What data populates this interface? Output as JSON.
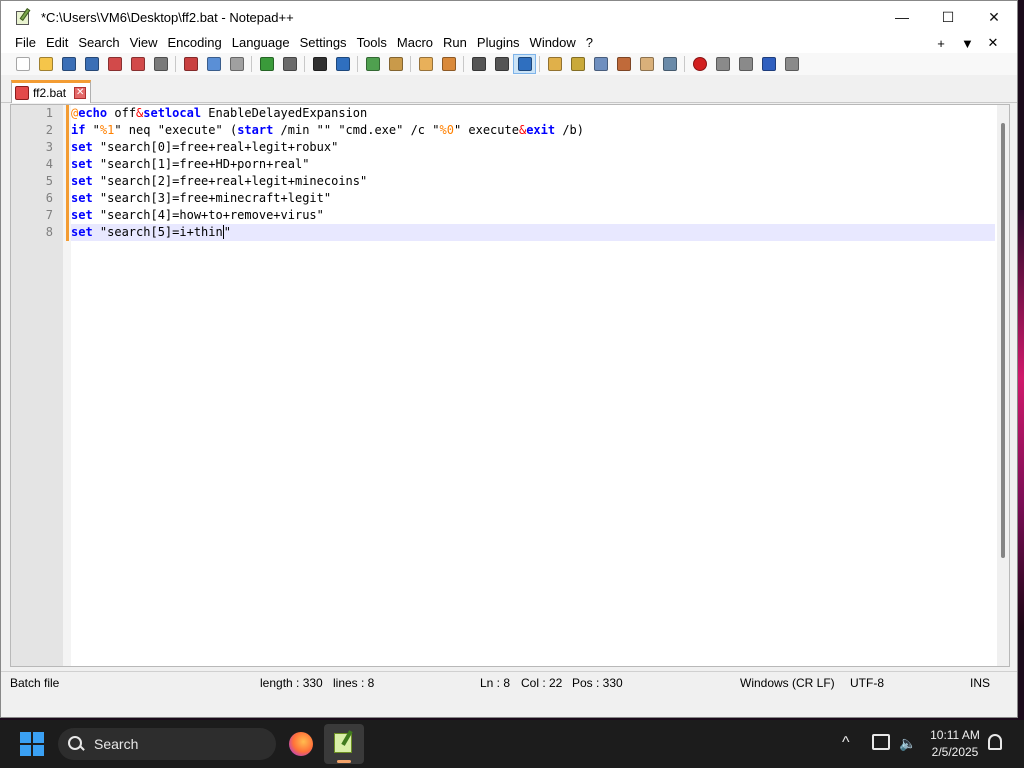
{
  "window": {
    "title": "*C:\\Users\\VM6\\Desktop\\ff2.bat - Notepad++",
    "controls": {
      "minimize": "—",
      "maximize": "☐",
      "close": "✕"
    }
  },
  "menu": {
    "items": [
      "File",
      "Edit",
      "Search",
      "View",
      "Encoding",
      "Language",
      "Settings",
      "Tools",
      "Macro",
      "Run",
      "Plugins",
      "Window",
      "?"
    ],
    "right": {
      "plus": "+",
      "dropdown": "▼",
      "close": "✕"
    }
  },
  "toolbar": {
    "buttons": [
      {
        "name": "new-file",
        "color": "#ffffff"
      },
      {
        "name": "open-file",
        "color": "#f5c54a"
      },
      {
        "name": "save",
        "color": "#3b6fb6"
      },
      {
        "name": "save-all",
        "color": "#3b6fb6"
      },
      {
        "name": "close",
        "color": "#d24a4a"
      },
      {
        "name": "close-all",
        "color": "#d24a4a"
      },
      {
        "name": "print",
        "color": "#7a7a7a"
      },
      {
        "name": "cut",
        "color": "#c94040"
      },
      {
        "name": "copy",
        "color": "#5a8fd6"
      },
      {
        "name": "paste",
        "color": "#a0a0a0"
      },
      {
        "name": "undo",
        "color": "#3a9a3a"
      },
      {
        "name": "redo",
        "color": "#6a6a6a"
      },
      {
        "name": "find",
        "color": "#303030"
      },
      {
        "name": "replace",
        "color": "#2f6fbf"
      },
      {
        "name": "zoom-in",
        "color": "#4fa04f"
      },
      {
        "name": "zoom-out",
        "color": "#c99a4a"
      },
      {
        "name": "sync-v",
        "color": "#e8b05a"
      },
      {
        "name": "sync-h",
        "color": "#d9893a"
      },
      {
        "name": "word-wrap",
        "color": "#555555"
      },
      {
        "name": "all-chars",
        "color": "#555555"
      },
      {
        "name": "indent-guide",
        "color": "#2f6fbf"
      },
      {
        "name": "define-lang",
        "color": "#e0b04a"
      },
      {
        "name": "doc-map",
        "color": "#c9a93a"
      },
      {
        "name": "doc-list",
        "color": "#6f8fbf"
      },
      {
        "name": "function-list",
        "color": "#c06a3a"
      },
      {
        "name": "folder-workspace",
        "color": "#d9b07a"
      },
      {
        "name": "monitoring",
        "color": "#6a8aa8"
      },
      {
        "name": "record-macro",
        "color": "#d21f1f"
      },
      {
        "name": "stop-record",
        "color": "#8a8a8a"
      },
      {
        "name": "play-macro",
        "color": "#8a8a8a"
      },
      {
        "name": "run-macro-multiple",
        "color": "#2f5fbf"
      },
      {
        "name": "save-macro",
        "color": "#8a8a8a"
      }
    ]
  },
  "tab": {
    "label": "ff2.bat",
    "close": "✕"
  },
  "editor": {
    "line_numbers": [
      "1",
      "2",
      "3",
      "4",
      "5",
      "6",
      "7",
      "8"
    ],
    "current_line": 8,
    "lines": [
      [
        {
          "t": "at",
          "v": "@"
        },
        {
          "t": "kw",
          "v": "echo"
        },
        {
          "t": "txt",
          "v": " off"
        },
        {
          "t": "op",
          "v": "&"
        },
        {
          "t": "kw",
          "v": "setlocal"
        },
        {
          "t": "txt",
          "v": " EnableDelayedExpansion"
        }
      ],
      [
        {
          "t": "kw",
          "v": "if"
        },
        {
          "t": "txt",
          "v": " \""
        },
        {
          "t": "var",
          "v": "%1"
        },
        {
          "t": "txt",
          "v": "\" neq \"execute\" ("
        },
        {
          "t": "kw",
          "v": "start"
        },
        {
          "t": "txt",
          "v": " /min \"\" \"cmd.exe\" /c \""
        },
        {
          "t": "var",
          "v": "%0"
        },
        {
          "t": "txt",
          "v": "\" execute"
        },
        {
          "t": "op",
          "v": "&"
        },
        {
          "t": "kw",
          "v": "exit"
        },
        {
          "t": "txt",
          "v": " /b)"
        }
      ],
      [
        {
          "t": "kw",
          "v": "set"
        },
        {
          "t": "txt",
          "v": " \"search[0]=free+real+legit+robux\""
        }
      ],
      [
        {
          "t": "kw",
          "v": "set"
        },
        {
          "t": "txt",
          "v": " \"search[1]=free+HD+porn+real\""
        }
      ],
      [
        {
          "t": "kw",
          "v": "set"
        },
        {
          "t": "txt",
          "v": " \"search[2]=free+real+legit+minecoins\""
        }
      ],
      [
        {
          "t": "kw",
          "v": "set"
        },
        {
          "t": "txt",
          "v": " \"search[3]=free+minecraft+legit\""
        }
      ],
      [
        {
          "t": "kw",
          "v": "set"
        },
        {
          "t": "txt",
          "v": " \"search[4]=how+to+remove+virus\""
        }
      ],
      [
        {
          "t": "kw",
          "v": "set"
        },
        {
          "t": "txt",
          "v": " \"search[5]=i+thin"
        },
        {
          "t": "caret",
          "v": ""
        },
        {
          "t": "txt",
          "v": "\""
        }
      ]
    ]
  },
  "status": {
    "file_type": "Batch file",
    "length": "length : 330",
    "lines": "lines : 8",
    "ln": "Ln : 8",
    "col": "Col : 22",
    "pos": "Pos : 330",
    "eol": "Windows (CR LF)",
    "encoding": "UTF-8",
    "mode": "INS"
  },
  "taskbar": {
    "search_label": "Search",
    "clock_time": "10:11 AM",
    "clock_date": "2/5/2025",
    "chevron": "^",
    "volume": "🔈"
  },
  "colors": {
    "keyword": "#0000ff",
    "operator": "#ff0000",
    "variable": "#ff8000",
    "current_line": "#e8e8ff",
    "tab_accent": "#f39c33",
    "taskbar": "#1c1c1c"
  }
}
